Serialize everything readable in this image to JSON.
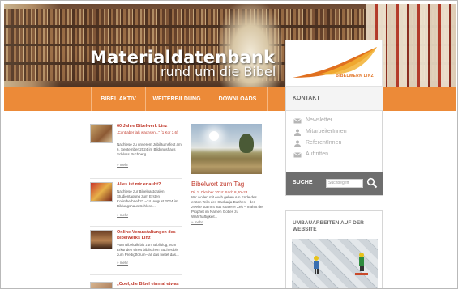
{
  "banner": {
    "title": "Materialdatenbank",
    "subtitle": "rund um die Bibel"
  },
  "logo": {
    "text": "BIBELWERK LINZ",
    "colors": {
      "primary": "#e0701f",
      "secondary": "#f2b233"
    }
  },
  "nav": {
    "items": [
      {
        "label": "BIBEL AKTIV"
      },
      {
        "label": "WEITERBILDUNG"
      },
      {
        "label": "DOWNLOADS"
      }
    ]
  },
  "kontakt": {
    "title": "KONTAKT",
    "items": [
      {
        "label": "Newsletter",
        "icon": "mail-icon"
      },
      {
        "label": "MitarbeiterInnen",
        "icon": "person-icon"
      },
      {
        "label": "ReferentInnen",
        "icon": "person-icon"
      },
      {
        "label": "Auftritten",
        "icon": "mail-icon"
      }
    ],
    "search": {
      "label": "SUCHE",
      "placeholder": "Suchbegriff"
    }
  },
  "umbau": {
    "title": "UMBAUARBEITEN AUF DER WEBSITE"
  },
  "news": [
    {
      "title": "60 Jahre Bibelwerk Linz",
      "subtitle": "„Cont aber laß wachsen...“ (1 Kor 3,6)",
      "text": "Nachlese zu unserem Jubiläumsfest am 6. September 2024 im Bildungshaus Schloss Puchberg",
      "more": "» mehr"
    },
    {
      "title": "Alles ist mir erlaubt?",
      "text": "Nachlese zur Bibelpastoralen Studientagung zum Ersten Korintherbrief 22.–24. August 2024 im Bildungshaus Schloss...",
      "more": "» mehr"
    },
    {
      "title": "Online-Veranstaltungen des Bibelwerks Linz",
      "text": "Vom Bibeltalk bis zum Bibliolog, vom Erkunden eines biblischen Buches bis zum Predigtforum– all das bietet das...",
      "more": "» mehr"
    },
    {
      "title": "„Cool, die Bibel einmal etwas"
    }
  ],
  "bibelwort": {
    "title": "Bibelwort zum Tag",
    "date": "Di, 1. Oktober 2024: Sach 8,20–23",
    "text": "Wir wollen mit euch gehen Am Ende des ersten Teils des Sacharja-Buches – der zweite stammt aus späterer Zeit – mahnt der Prophet im Namen Gottes zu Wahrhaftigkeit...",
    "more": "» mehr"
  },
  "theme": {
    "accent": "#ec8a38",
    "link": "#c0392b",
    "search_bar": "#6e6e6e"
  }
}
